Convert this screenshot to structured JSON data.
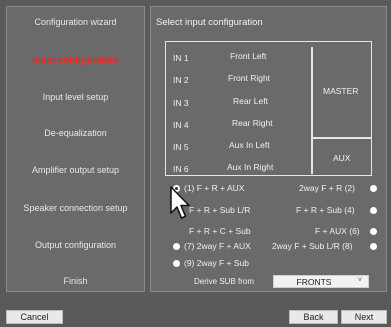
{
  "sidebar": {
    "items": [
      {
        "label": "Configuration wizard"
      },
      {
        "label": "Input configuration"
      },
      {
        "label": "Input level setup"
      },
      {
        "label": "De-equalization"
      },
      {
        "label": "Amplifier output setup"
      },
      {
        "label": "Speaker connection setup"
      },
      {
        "label": "Output configuration"
      },
      {
        "label": "Finish"
      }
    ],
    "active_index": 1
  },
  "main": {
    "title": "Select input configuration",
    "inputs": [
      {
        "id": "IN 1",
        "name": "Front Left"
      },
      {
        "id": "IN 2",
        "name": "Front Right"
      },
      {
        "id": "IN 3",
        "name": "Rear Left"
      },
      {
        "id": "IN 4",
        "name": "Rear Right"
      },
      {
        "id": "IN 5",
        "name": "Aux In Left"
      },
      {
        "id": "IN 6",
        "name": "Aux In Right"
      }
    ],
    "groups": {
      "master": "MASTER",
      "aux": "AUX"
    },
    "options": [
      {
        "label": "(1) F + R + AUX",
        "checked": true
      },
      {
        "label": "2way F + R (2)",
        "checked": false
      },
      {
        "label": "F + R + Sub L/R",
        "checked": false
      },
      {
        "label": "F + R + Sub (4)",
        "checked": false
      },
      {
        "label": "F + R + C + Sub",
        "checked": false
      },
      {
        "label": "F + AUX (6)",
        "checked": false
      },
      {
        "label": "(7) 2way F + AUX",
        "checked": false
      },
      {
        "label": "2way F + Sub L/R (8)",
        "checked": false
      },
      {
        "label": "(9) 2way F + Sub",
        "checked": false
      }
    ],
    "derive_label": "Derive SUB from",
    "derive_value": "FRONTS",
    "derive_chevron": "˅"
  },
  "footer": {
    "cancel": "Cancel",
    "back": "Back",
    "next": "Next"
  },
  "colors": {
    "background": "#5a5a5a",
    "panel": "#6a6a6a",
    "active_text": "#ff2020"
  }
}
